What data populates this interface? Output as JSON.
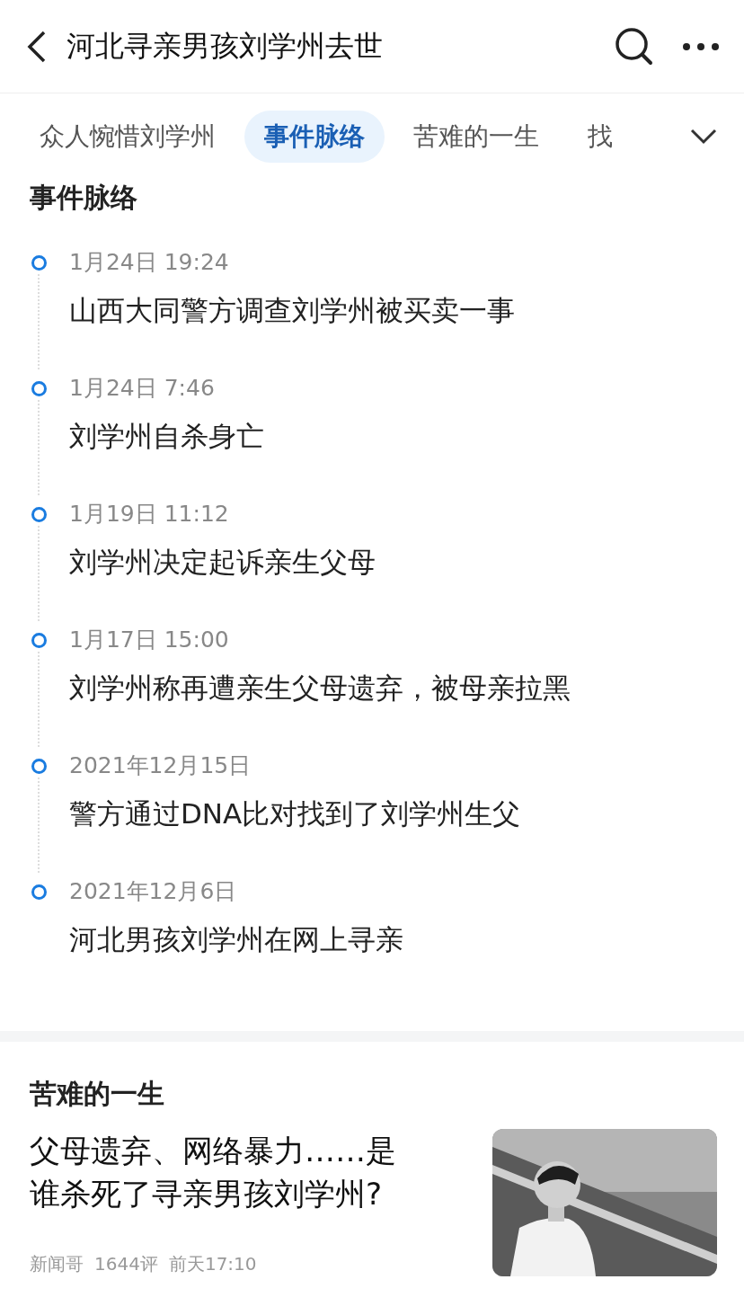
{
  "header": {
    "title": "河北寻亲男孩刘学州去世"
  },
  "tabs": [
    {
      "label": "众人惋惜刘学州",
      "selected": false
    },
    {
      "label": "事件脉络",
      "selected": true
    },
    {
      "label": "苦难的一生",
      "selected": false
    },
    {
      "label": "找",
      "selected": false
    }
  ],
  "timeline": {
    "title": "事件脉络",
    "events": [
      {
        "time": "1月24日 19:24",
        "text": "山西大同警方调查刘学州被买卖一事"
      },
      {
        "time": "1月24日 7:46",
        "text": "刘学州自杀身亡"
      },
      {
        "time": "1月19日 11:12",
        "text": "刘学州决定起诉亲生父母"
      },
      {
        "time": "1月17日 15:00",
        "text": "刘学州称再遭亲生父母遗弃，被母亲拉黑"
      },
      {
        "time": "2021年12月15日",
        "text": "警方通过DNA比对找到了刘学州生父"
      },
      {
        "time": "2021年12月6日",
        "text": "河北男孩刘学州在网上寻亲"
      }
    ]
  },
  "section": {
    "title": "苦难的一生",
    "articles": [
      {
        "title": "父母遗弃、网络暴力……是谁杀死了寻亲男孩刘学州?",
        "source": "新闻哥",
        "comments": "1644评",
        "time": "前天17:10"
      }
    ]
  }
}
